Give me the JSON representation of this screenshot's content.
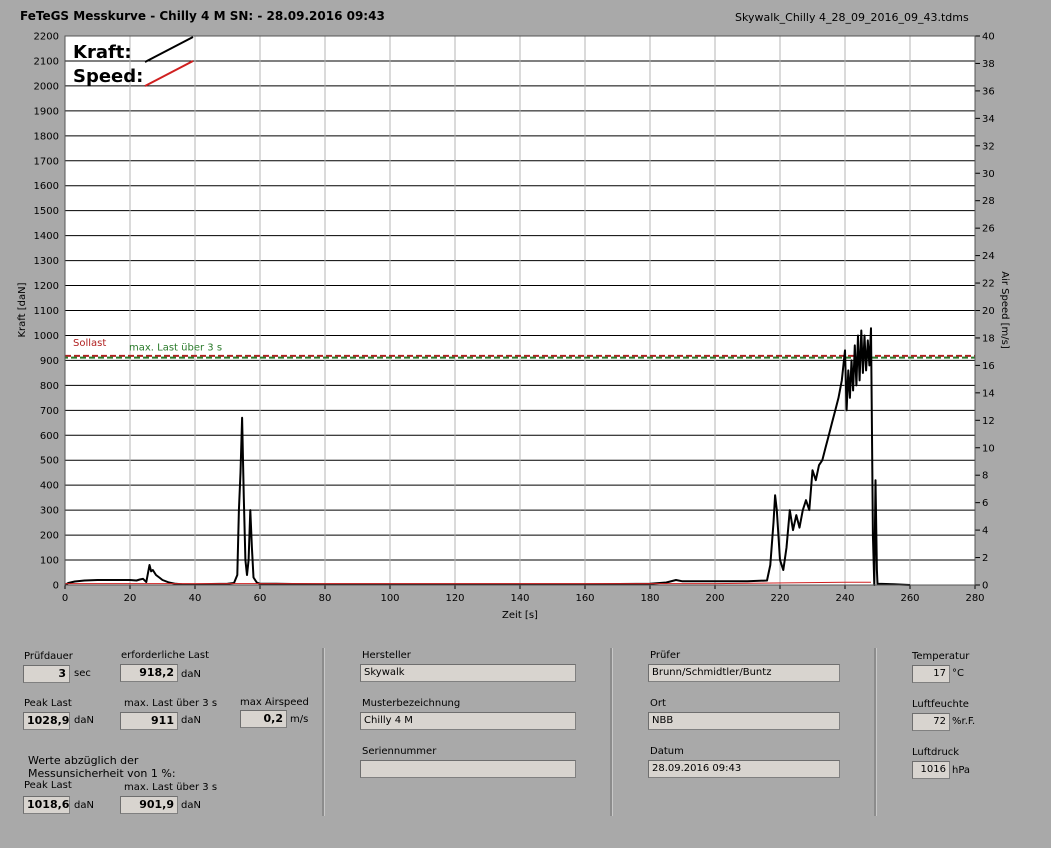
{
  "header": {
    "title": "FeTeGS Messkurve - Chilly 4 M  SN:  - 28.09.2016 09:43",
    "filename": "Skywalk_Chilly 4_28_09_2016_09_43.tdms"
  },
  "chart_data": {
    "type": "line",
    "xlabel": "Zeit [s]",
    "ylabel": "Kraft [daN]",
    "y2label": "Air Speed [m/s]",
    "xlim": [
      0,
      280
    ],
    "ylim": [
      0,
      2200
    ],
    "y2lim": [
      0,
      40
    ],
    "x_ticks": [
      0,
      20,
      40,
      60,
      80,
      100,
      120,
      140,
      160,
      180,
      200,
      220,
      240,
      260,
      280
    ],
    "y_ticks": [
      0,
      100,
      200,
      300,
      400,
      500,
      600,
      700,
      800,
      900,
      1000,
      1100,
      1200,
      1300,
      1400,
      1500,
      1600,
      1700,
      1800,
      1900,
      2000,
      2100,
      2200
    ],
    "y2_ticks": [
      0,
      2,
      4,
      6,
      8,
      10,
      12,
      14,
      16,
      18,
      20,
      22,
      24,
      26,
      28,
      30,
      32,
      34,
      36,
      38,
      40
    ],
    "grid": true,
    "legend": [
      {
        "name": "Kraft:",
        "color": "#000000"
      },
      {
        "name": "Speed:",
        "color": "#d02020"
      }
    ],
    "reference_lines": [
      {
        "label": "Sollast",
        "y": 918.2,
        "color": "#b02020"
      },
      {
        "label": "max. Last über  3 s",
        "y": 911,
        "color": "#2a7a2a"
      }
    ],
    "series": [
      {
        "name": "Kraft",
        "color": "#000000",
        "x": [
          0,
          1,
          3,
          6,
          10,
          15,
          20,
          22,
          23,
          24,
          25,
          26,
          26.5,
          27,
          28,
          29,
          30,
          32,
          34,
          36,
          40,
          45,
          50,
          52,
          53,
          53.5,
          54,
          54.5,
          55,
          55.5,
          56,
          56.5,
          57,
          57.5,
          58,
          59,
          60,
          65,
          70,
          80,
          100,
          120,
          140,
          160,
          180,
          185,
          188,
          190,
          195,
          200,
          210,
          216,
          217,
          218,
          218.5,
          219,
          220,
          221,
          222,
          223,
          224,
          225,
          226,
          227,
          228,
          229,
          230,
          231,
          232,
          233,
          234,
          235,
          236,
          237,
          238,
          239,
          240,
          240.5,
          241,
          241.5,
          242,
          242.5,
          243,
          243.5,
          244,
          244.5,
          245,
          245.5,
          246,
          246.5,
          247,
          247.5,
          248,
          248.3,
          248.6,
          249,
          249.4,
          249.8,
          250,
          255,
          260
        ],
        "values": [
          0,
          8,
          14,
          18,
          20,
          20,
          20,
          18,
          22,
          25,
          12,
          80,
          55,
          60,
          40,
          30,
          20,
          10,
          5,
          3,
          2,
          4,
          5,
          8,
          40,
          300,
          450,
          670,
          350,
          100,
          40,
          100,
          300,
          150,
          30,
          10,
          5,
          5,
          4,
          3,
          3,
          3,
          3,
          3,
          5,
          10,
          20,
          15,
          15,
          15,
          15,
          18,
          80,
          250,
          360,
          300,
          100,
          60,
          150,
          300,
          220,
          280,
          230,
          300,
          340,
          300,
          460,
          420,
          480,
          500,
          550,
          600,
          650,
          700,
          750,
          820,
          940,
          700,
          860,
          750,
          900,
          780,
          960,
          800,
          1000,
          820,
          1020,
          850,
          1000,
          860,
          980,
          880,
          1028.9,
          600,
          200,
          0,
          420,
          60,
          5,
          3,
          0
        ],
        "stroke_width": 2
      },
      {
        "name": "Speed",
        "color": "#d02020",
        "x": [
          0,
          10,
          20,
          30,
          40,
          50,
          60,
          100,
          150,
          200,
          240,
          248
        ],
        "values": [
          0.1,
          0.1,
          0.1,
          0.1,
          0.1,
          0.1,
          0.1,
          0.1,
          0.1,
          0.1,
          0.2,
          0.2
        ],
        "stroke_width": 1
      }
    ]
  },
  "panel_left": {
    "pruefdauer_label": "Prüfdauer",
    "pruefdauer_value": "3",
    "pruefdauer_unit": "sec",
    "erf_last_label": "erforderliche Last",
    "erf_last_value": "918,2",
    "erf_last_unit": "daN",
    "peak_last_label": "Peak Last",
    "peak_last_value": "1028,9",
    "peak_last_unit": "daN",
    "max_last_label": "max. Last über  3 s",
    "max_last_value": "911",
    "max_last_unit": "daN",
    "max_airspeed_label": "max Airspeed",
    "max_airspeed_value": "0,2",
    "max_airspeed_unit": "m/s",
    "note_line1": "Werte abzüglich der",
    "note_line2": "Messunsicherheit von 1  %:",
    "peak_last2_label": "Peak Last",
    "peak_last2_value": "1018,6",
    "peak_last2_unit": "daN",
    "max_last2_label": "max. Last über  3 s",
    "max_last2_value": "901,9",
    "max_last2_unit": "daN"
  },
  "panel_mid": {
    "hersteller_label": "Hersteller",
    "hersteller_value": "Skywalk",
    "muster_label": "Musterbezeichnung",
    "muster_value": "Chilly 4 M",
    "serien_label": "Seriennummer",
    "serien_value": ""
  },
  "panel_right": {
    "pruefer_label": "Prüfer",
    "pruefer_value": "Brunn/Schmidtler/Buntz",
    "ort_label": "Ort",
    "ort_value": "NBB",
    "datum_label": "Datum",
    "datum_value": "28.09.2016 09:43"
  },
  "panel_env": {
    "temp_label": "Temperatur",
    "temp_value": "17",
    "temp_unit": "°C",
    "feuchte_label": "Luftfeuchte",
    "feuchte_value": "72",
    "feuchte_unit": "%r.F.",
    "druck_label": "Luftdruck",
    "druck_value": "1016",
    "druck_unit": "hPa"
  }
}
